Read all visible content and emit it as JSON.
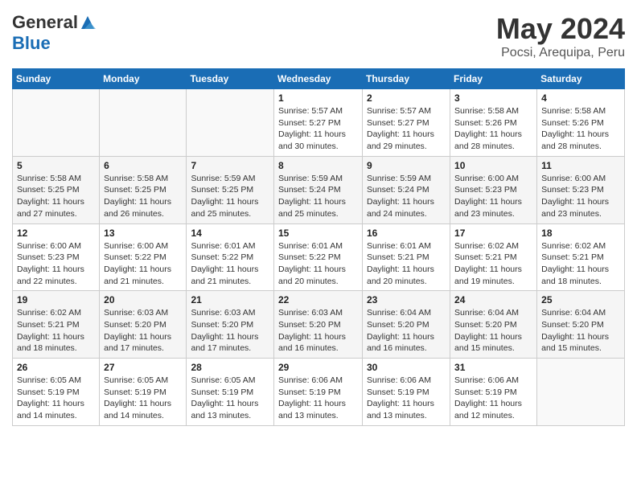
{
  "header": {
    "logo_general": "General",
    "logo_blue": "Blue",
    "title": "May 2024",
    "location": "Pocsi, Arequipa, Peru"
  },
  "weekdays": [
    "Sunday",
    "Monday",
    "Tuesday",
    "Wednesday",
    "Thursday",
    "Friday",
    "Saturday"
  ],
  "weeks": [
    [
      {
        "day": "",
        "info": ""
      },
      {
        "day": "",
        "info": ""
      },
      {
        "day": "",
        "info": ""
      },
      {
        "day": "1",
        "info": "Sunrise: 5:57 AM\nSunset: 5:27 PM\nDaylight: 11 hours and 30 minutes."
      },
      {
        "day": "2",
        "info": "Sunrise: 5:57 AM\nSunset: 5:27 PM\nDaylight: 11 hours and 29 minutes."
      },
      {
        "day": "3",
        "info": "Sunrise: 5:58 AM\nSunset: 5:26 PM\nDaylight: 11 hours and 28 minutes."
      },
      {
        "day": "4",
        "info": "Sunrise: 5:58 AM\nSunset: 5:26 PM\nDaylight: 11 hours and 28 minutes."
      }
    ],
    [
      {
        "day": "5",
        "info": "Sunrise: 5:58 AM\nSunset: 5:25 PM\nDaylight: 11 hours and 27 minutes."
      },
      {
        "day": "6",
        "info": "Sunrise: 5:58 AM\nSunset: 5:25 PM\nDaylight: 11 hours and 26 minutes."
      },
      {
        "day": "7",
        "info": "Sunrise: 5:59 AM\nSunset: 5:25 PM\nDaylight: 11 hours and 25 minutes."
      },
      {
        "day": "8",
        "info": "Sunrise: 5:59 AM\nSunset: 5:24 PM\nDaylight: 11 hours and 25 minutes."
      },
      {
        "day": "9",
        "info": "Sunrise: 5:59 AM\nSunset: 5:24 PM\nDaylight: 11 hours and 24 minutes."
      },
      {
        "day": "10",
        "info": "Sunrise: 6:00 AM\nSunset: 5:23 PM\nDaylight: 11 hours and 23 minutes."
      },
      {
        "day": "11",
        "info": "Sunrise: 6:00 AM\nSunset: 5:23 PM\nDaylight: 11 hours and 23 minutes."
      }
    ],
    [
      {
        "day": "12",
        "info": "Sunrise: 6:00 AM\nSunset: 5:23 PM\nDaylight: 11 hours and 22 minutes."
      },
      {
        "day": "13",
        "info": "Sunrise: 6:00 AM\nSunset: 5:22 PM\nDaylight: 11 hours and 21 minutes."
      },
      {
        "day": "14",
        "info": "Sunrise: 6:01 AM\nSunset: 5:22 PM\nDaylight: 11 hours and 21 minutes."
      },
      {
        "day": "15",
        "info": "Sunrise: 6:01 AM\nSunset: 5:22 PM\nDaylight: 11 hours and 20 minutes."
      },
      {
        "day": "16",
        "info": "Sunrise: 6:01 AM\nSunset: 5:21 PM\nDaylight: 11 hours and 20 minutes."
      },
      {
        "day": "17",
        "info": "Sunrise: 6:02 AM\nSunset: 5:21 PM\nDaylight: 11 hours and 19 minutes."
      },
      {
        "day": "18",
        "info": "Sunrise: 6:02 AM\nSunset: 5:21 PM\nDaylight: 11 hours and 18 minutes."
      }
    ],
    [
      {
        "day": "19",
        "info": "Sunrise: 6:02 AM\nSunset: 5:21 PM\nDaylight: 11 hours and 18 minutes."
      },
      {
        "day": "20",
        "info": "Sunrise: 6:03 AM\nSunset: 5:20 PM\nDaylight: 11 hours and 17 minutes."
      },
      {
        "day": "21",
        "info": "Sunrise: 6:03 AM\nSunset: 5:20 PM\nDaylight: 11 hours and 17 minutes."
      },
      {
        "day": "22",
        "info": "Sunrise: 6:03 AM\nSunset: 5:20 PM\nDaylight: 11 hours and 16 minutes."
      },
      {
        "day": "23",
        "info": "Sunrise: 6:04 AM\nSunset: 5:20 PM\nDaylight: 11 hours and 16 minutes."
      },
      {
        "day": "24",
        "info": "Sunrise: 6:04 AM\nSunset: 5:20 PM\nDaylight: 11 hours and 15 minutes."
      },
      {
        "day": "25",
        "info": "Sunrise: 6:04 AM\nSunset: 5:20 PM\nDaylight: 11 hours and 15 minutes."
      }
    ],
    [
      {
        "day": "26",
        "info": "Sunrise: 6:05 AM\nSunset: 5:19 PM\nDaylight: 11 hours and 14 minutes."
      },
      {
        "day": "27",
        "info": "Sunrise: 6:05 AM\nSunset: 5:19 PM\nDaylight: 11 hours and 14 minutes."
      },
      {
        "day": "28",
        "info": "Sunrise: 6:05 AM\nSunset: 5:19 PM\nDaylight: 11 hours and 13 minutes."
      },
      {
        "day": "29",
        "info": "Sunrise: 6:06 AM\nSunset: 5:19 PM\nDaylight: 11 hours and 13 minutes."
      },
      {
        "day": "30",
        "info": "Sunrise: 6:06 AM\nSunset: 5:19 PM\nDaylight: 11 hours and 13 minutes."
      },
      {
        "day": "31",
        "info": "Sunrise: 6:06 AM\nSunset: 5:19 PM\nDaylight: 11 hours and 12 minutes."
      },
      {
        "day": "",
        "info": ""
      }
    ]
  ]
}
